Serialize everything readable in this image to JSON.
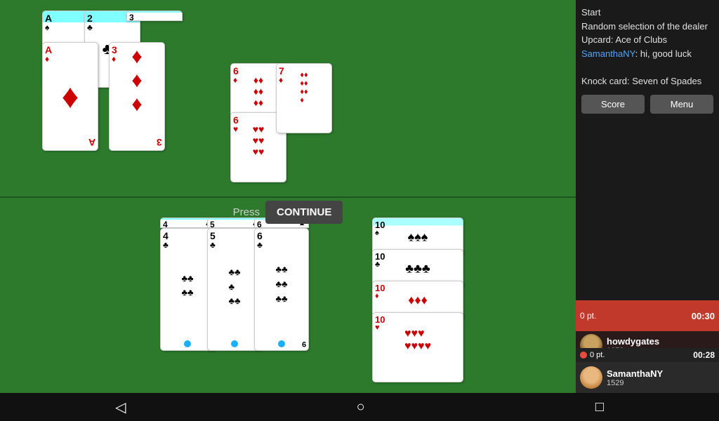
{
  "sidebar": {
    "log": [
      "Start",
      "Random selection of the dealer",
      "Upcard: Ace of Clubs",
      "SamanthaNY: hi, good luck",
      "",
      "Knock card: Seven of Spades"
    ],
    "username_highlight": "SamanthaNY",
    "score_btn": "Score",
    "menu_btn": "Menu"
  },
  "players": [
    {
      "name": "howdygates",
      "score": "1372",
      "pt": "0 pt.",
      "timer": "00:30",
      "active": true
    },
    {
      "name": "SamanthaNY",
      "score": "1529",
      "pt": "0 pt.",
      "timer": "00:28",
      "active": false
    }
  ],
  "continue": {
    "press_label": "Press",
    "button_label": "CONTINUE"
  },
  "nav": {
    "back_icon": "◁",
    "home_icon": "○",
    "square_icon": "□"
  },
  "top_cards": {
    "group1": [
      {
        "value": "A",
        "suit": "♠",
        "color": "black"
      },
      {
        "value": "A",
        "suit": "♠",
        "color": "black"
      },
      {
        "value": "A",
        "suit": "♦",
        "color": "red"
      }
    ],
    "group2": [
      {
        "value": "2",
        "suit": "♣",
        "color": "black"
      },
      {
        "value": "3",
        "suit": "♦",
        "color": "red"
      }
    ],
    "group3": [
      {
        "value": "6",
        "suit": "♦",
        "color": "red"
      },
      {
        "value": "7",
        "suit": "♦",
        "color": "red"
      },
      {
        "value": "6",
        "suit": "♥",
        "color": "red"
      }
    ]
  },
  "bottom_cards": {
    "group1": [
      {
        "value": "4",
        "suit": "♠",
        "color": "black"
      },
      {
        "value": "5",
        "suit": "♠",
        "color": "black"
      },
      {
        "value": "6",
        "suit": "♠",
        "color": "black"
      }
    ],
    "group2": [
      {
        "value": "4",
        "suit": "♣",
        "color": "black"
      },
      {
        "value": "5",
        "suit": "♣",
        "color": "black"
      },
      {
        "value": "6",
        "suit": "♣",
        "color": "black"
      }
    ],
    "right_cards": [
      {
        "value": "10",
        "suit": "♠",
        "color": "black"
      },
      {
        "value": "10",
        "suit": "♣",
        "color": "black"
      },
      {
        "value": "10",
        "suit": "♦",
        "color": "red"
      },
      {
        "value": "10",
        "suit": "♥",
        "color": "red"
      }
    ]
  }
}
